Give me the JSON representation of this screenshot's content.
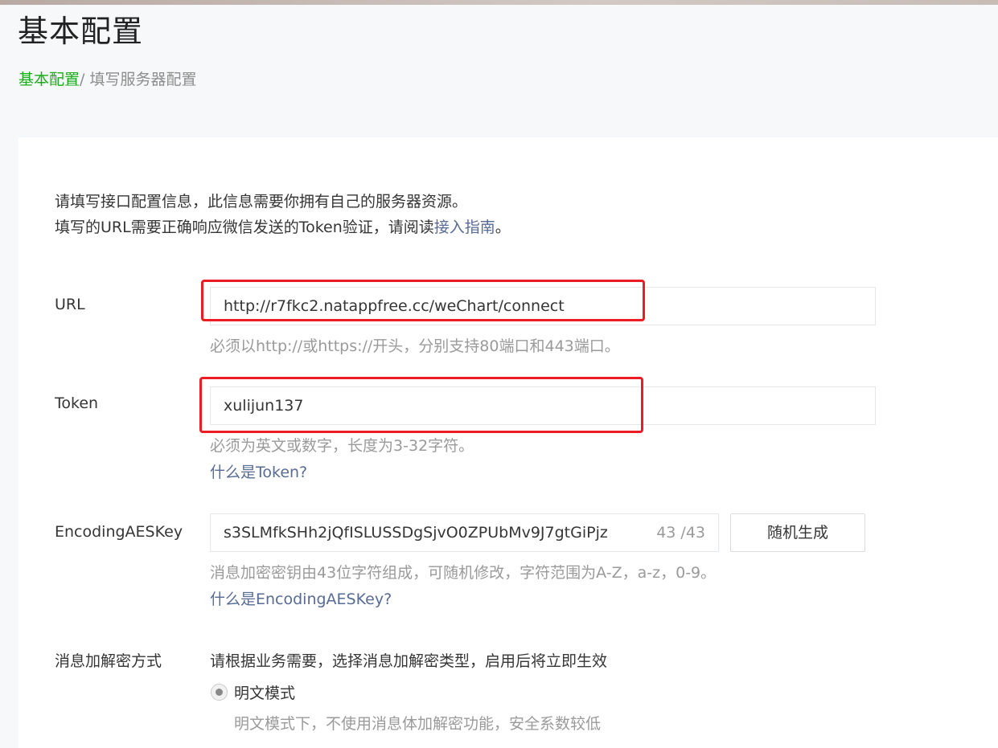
{
  "header": {
    "title": "基本配置",
    "breadcrumb_root": "基本配置",
    "breadcrumb_sep": "/ ",
    "breadcrumb_current": "填写服务器配置"
  },
  "intro": {
    "line1": "请填写接口配置信息，此信息需要你拥有自己的服务器资源。",
    "line2_prefix": "填写的URL需要正确响应微信发送的Token验证，请阅读",
    "line2_link": "接入指南",
    "line2_suffix": "。"
  },
  "url_field": {
    "label": "URL",
    "value": "http://r7fkc2.natappfree.cc/weChart/connect",
    "hint": "必须以http://或https://开头，分别支持80端口和443端口。"
  },
  "token_field": {
    "label": "Token",
    "value": "xulijun137",
    "hint": "必须为英文或数字，长度为3-32字符。",
    "help": "什么是Token?"
  },
  "aes_field": {
    "label": "EncodingAESKey",
    "value": "s3SLMfkSHh2jQfISLUSSDgSjvO0ZPUbMv9J7gtGiPjz",
    "counter": "43 /43",
    "generate_button": "随机生成",
    "hint": "消息加密密钥由43位字符组成，可随机修改，字符范围为A-Z，a-z，0-9。",
    "help": "什么是EncodingAESKey?"
  },
  "encryption": {
    "label": "消息加解密方式",
    "description": "请根据业务需要，选择消息加解密类型，启用后将立即生效",
    "option1_label": "明文模式",
    "option1_hint": "明文模式下，不使用消息体加解密功能，安全系数较低"
  },
  "colors": {
    "link_green": "#1aad19",
    "link_blue": "#576b95",
    "annotation_red": "#ec1c24"
  }
}
